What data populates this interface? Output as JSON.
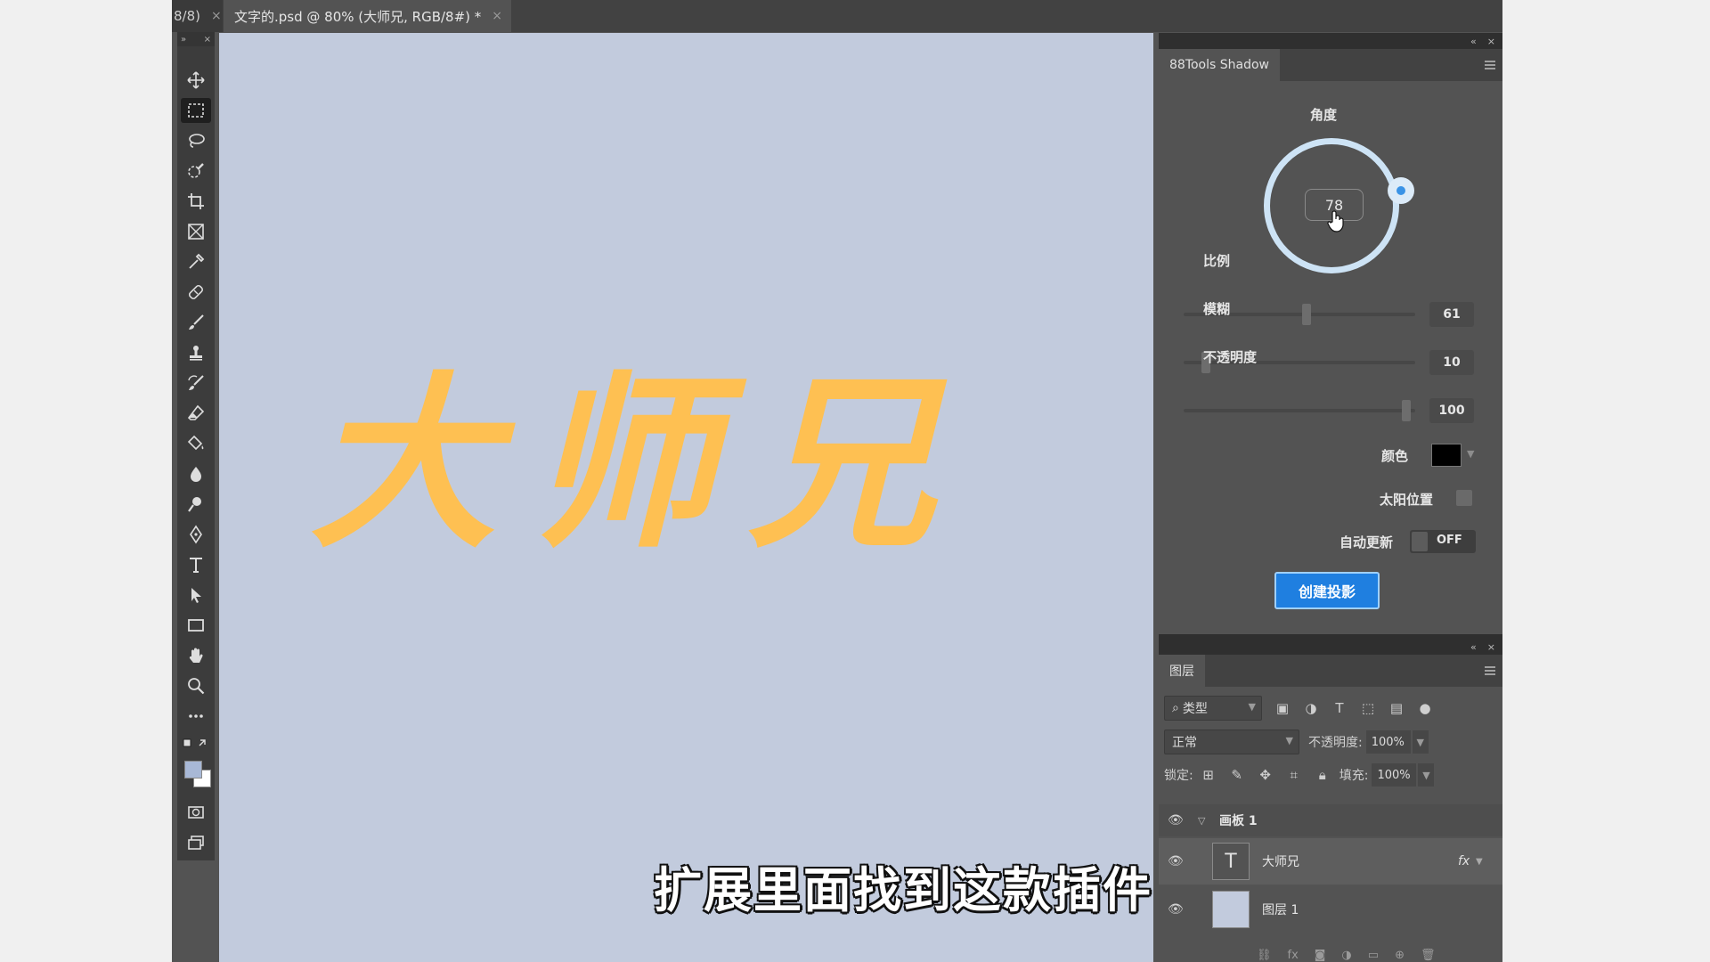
{
  "tabs": {
    "prev_label": "8/8)",
    "active_label": "文字的.psd @ 80% (大师兄, RGB/8#) *",
    "close": "×"
  },
  "toolbar": {
    "collapse": "»",
    "close": "×",
    "tools": [
      "move",
      "rect-marquee",
      "lasso",
      "quick-select",
      "crop",
      "frame",
      "eyedropper",
      "healing",
      "brush",
      "stamp",
      "history-brush",
      "eraser",
      "paint-bucket",
      "blur",
      "dodge",
      "pen",
      "type",
      "path-select",
      "rectangle",
      "hand",
      "zoom",
      "more"
    ],
    "foreground_color": "#a8b8d6",
    "background_color": "#ffffff"
  },
  "canvas": {
    "headline": "大师兄",
    "headline_color": "#fec052",
    "background": "#c2cbdd"
  },
  "caption": "扩展里面找到这款插件",
  "shadow_panel": {
    "title": "88Tools Shadow",
    "angle_label": "角度",
    "angle_value": "78",
    "scale_label": "比例",
    "scale_value": "61",
    "blur_label": "模糊",
    "blur_value": "10",
    "opacity_label": "不透明度",
    "opacity_value": "100",
    "sliders": {
      "scale": 0.53,
      "blur": 0.08,
      "opacity": 0.98
    },
    "color_label": "颜色",
    "color_value": "#000000",
    "sun_label": "太阳位置",
    "auto_label": "自动更新",
    "auto_state": "OFF",
    "create_button": "创建投影"
  },
  "layers_panel": {
    "title": "图层",
    "filter_kind": "类型",
    "blend_mode": "正常",
    "opacity_label": "不透明度:",
    "opacity_value": "100%",
    "lock_label": "锁定:",
    "fill_label": "填充:",
    "fill_value": "100%",
    "group_name": "画板 1",
    "layers": [
      {
        "name": "大师兄",
        "kind": "text",
        "fx": "fx"
      },
      {
        "name": "图层 1",
        "kind": "pixel"
      }
    ]
  }
}
